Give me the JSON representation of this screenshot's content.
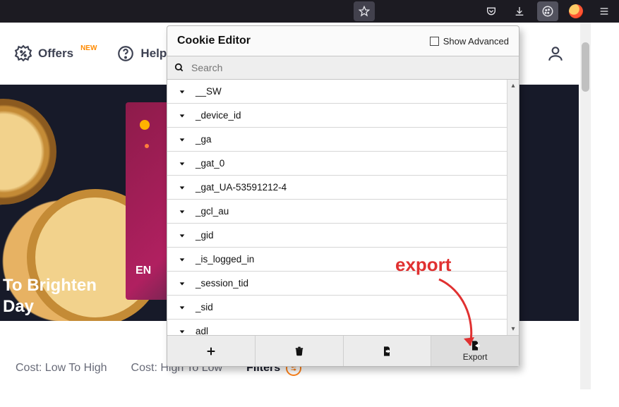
{
  "browser": {
    "icons": {
      "star": "star-icon",
      "pocket": "pocket-icon",
      "downloads": "downloads-icon",
      "cookieExt": "cookie-editor-icon",
      "otherExt": "extension-icon",
      "menu": "hamburger-menu-icon"
    }
  },
  "page": {
    "nav": {
      "offers": "Offers",
      "offersBadge": "NEW",
      "help": "Help"
    },
    "hero": {
      "line1": "To Brighten",
      "line2": "Day",
      "promo": "EN"
    },
    "filters": {
      "a": "Cost: Low To High",
      "b": "Cost: High To Low",
      "c": "Filters"
    }
  },
  "popup": {
    "title": "Cookie Editor",
    "showAdvanced": "Show Advanced",
    "searchPlaceholder": "Search",
    "cookies": [
      "__SW",
      "_device_id",
      "_ga",
      "_gat_0",
      "_gat_UA-53591212-4",
      "_gcl_au",
      "_gid",
      "_is_logged_in",
      "_session_tid",
      "_sid",
      "adl"
    ],
    "toolbar": {
      "add": "",
      "delete": "",
      "import": "",
      "export": "Export"
    }
  },
  "annotation": {
    "text": "export"
  }
}
